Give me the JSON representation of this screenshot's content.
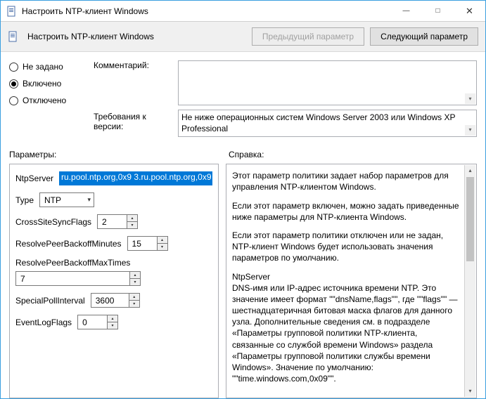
{
  "window": {
    "title": "Настроить NTP-клиент Windows"
  },
  "toolbar": {
    "heading": "Настроить NTP-клиент Windows",
    "prev": "Предыдущий параметр",
    "next": "Следующий параметр"
  },
  "state": {
    "not_configured": "Не задано",
    "enabled": "Включено",
    "disabled": "Отключено",
    "selected": "enabled"
  },
  "labels": {
    "comment": "Комментарий:",
    "requirements": "Требования к версии:",
    "params_section": "Параметры:",
    "help_section": "Справка:"
  },
  "requirements_text": "Не ниже операционных систем Windows Server 2003 или Windows XP Professional",
  "params": {
    "ntpserver_label": "NtpServer",
    "ntpserver_value": "ru.pool.ntp.org,0x9 3.ru.pool.ntp.org,0x9",
    "type_label": "Type",
    "type_value": "NTP",
    "cross_label": "CrossSiteSyncFlags",
    "cross_value": "2",
    "rpbm_label": "ResolvePeerBackoffMinutes",
    "rpbm_value": "15",
    "rpbmt_label": "ResolvePeerBackoffMaxTimes",
    "rpbmt_value": "7",
    "spi_label": "SpecialPollInterval",
    "spi_value": "3600",
    "elf_label": "EventLogFlags",
    "elf_value": "0"
  },
  "help": {
    "p1": "Этот параметр политики задает набор параметров для управления NTP-клиентом Windows.",
    "p2": "Если этот параметр включен, можно задать приведенные ниже параметры для NTP-клиента Windows.",
    "p3": "Если этот параметр политики отключен или не задан, NTP-клиент Windows будет использовать значения параметров по умолчанию.",
    "p4a": "NtpServer",
    "p4b": "DNS-имя или IP-адрес источника времени NTP. Это значение имеет формат \"\"dnsName,flags\"\", где \"\"flags\"\" — шестнадцатеричная битовая маска флагов для данного узла. Дополнительные сведения см. в подразделе «Параметры групповой политики NTP-клиента, связанные со службой времени Windows» раздела «Параметры групповой политики службы времени Windows».  Значение по умолчанию: \"\"time.windows.com,0x09\"\"."
  }
}
